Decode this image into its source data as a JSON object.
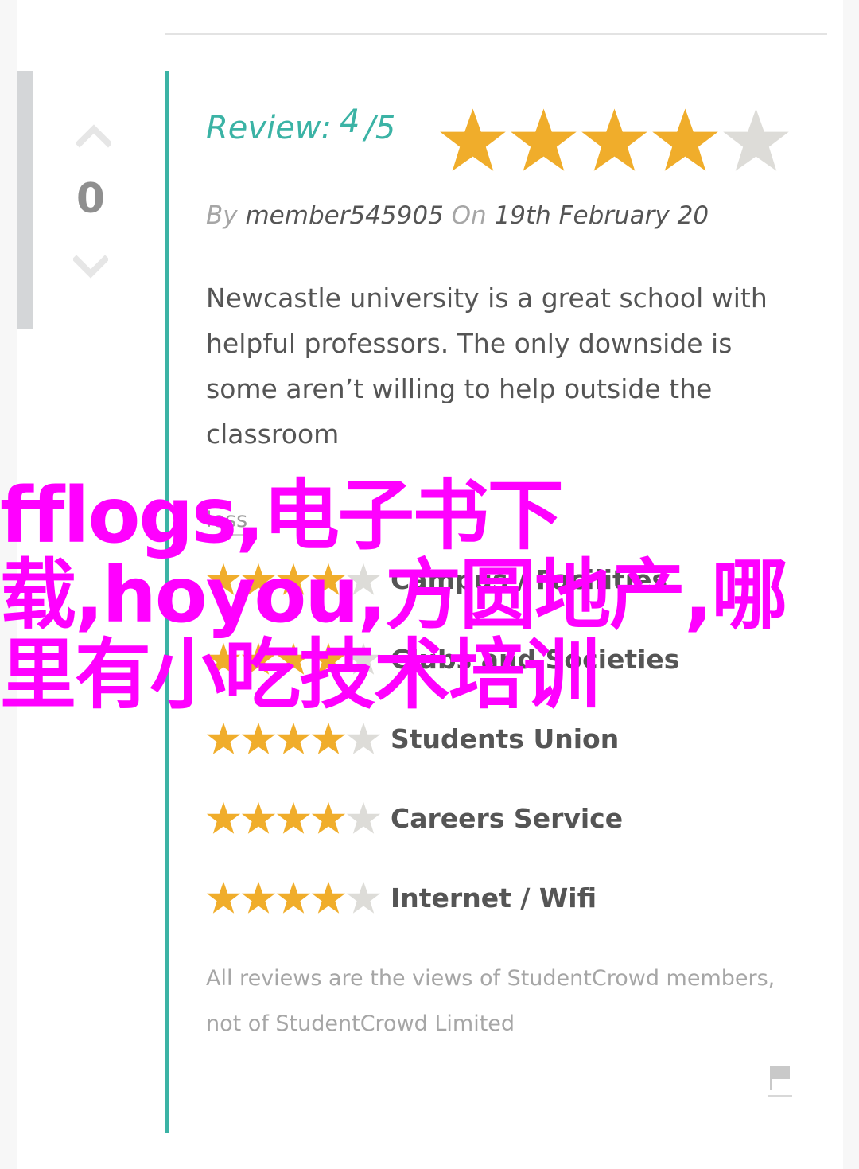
{
  "vote": {
    "count": "0",
    "up_icon": "chevron-up-icon",
    "down_icon": "chevron-down-icon"
  },
  "review": {
    "heading_label": "Review:",
    "score": "4",
    "out_of": "/5",
    "rating": 4,
    "max_rating": 5,
    "by_label": "By",
    "author": "member545905",
    "on_label": "On",
    "date": "19th February 20",
    "body": "Newcastle university is a great school with helpful professors. The only downside is some aren’t willing to help outside the classroom",
    "less_link": "less"
  },
  "categories": [
    {
      "label": "Campus / Facilities",
      "rating": 4
    },
    {
      "label": "Clubs and Societies",
      "rating": 4
    },
    {
      "label": "Students Union",
      "rating": 4
    },
    {
      "label": "Careers Service",
      "rating": 4
    },
    {
      "label": "Internet / Wifi",
      "rating": 4
    }
  ],
  "disclaimer": "All reviews are the views of StudentCrowd members, not of StudentCrowd Limited",
  "flag_icon": "flag-icon",
  "watermark": "fflogs,电子书下载,hoyou,方圆地产,哪里有小吃技术培训",
  "colors": {
    "accent": "#3bb3a5",
    "star_filled": "#f0ad2b",
    "star_empty": "#dddcd8",
    "watermark": "#ff00ff"
  }
}
